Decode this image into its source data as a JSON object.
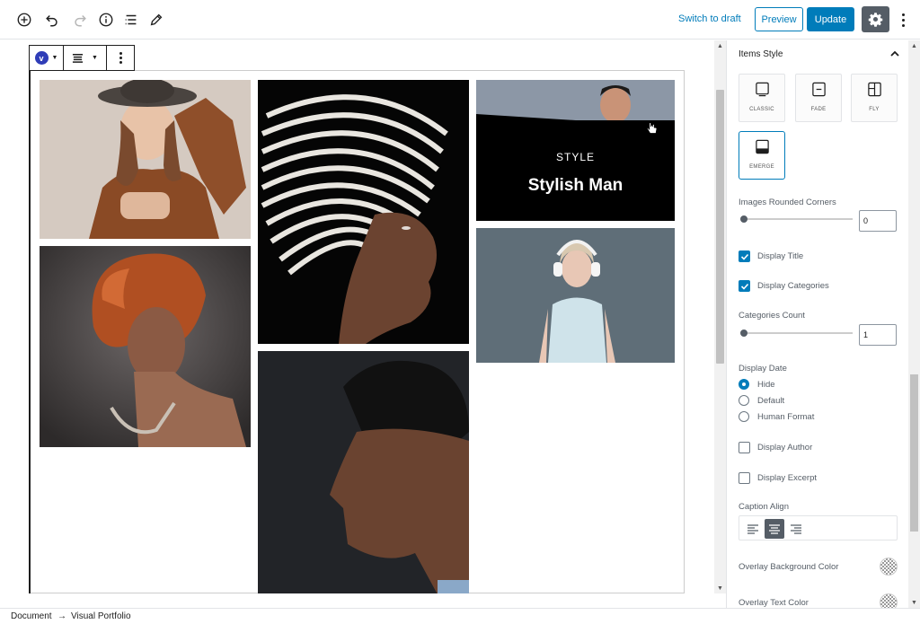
{
  "toolbar": {
    "icons": [
      "add-block-icon",
      "undo-icon",
      "redo-icon",
      "info-icon",
      "list-view-icon",
      "edit-tools-icon"
    ],
    "switch_draft": "Switch to draft",
    "preview": "Preview",
    "update": "Update",
    "settings_icon": "gear-icon",
    "more_icon": "more-vertical-icon",
    "accent_color": "#007cba"
  },
  "block_toolbar": {
    "block_icon_letter": "v",
    "block_icon": "visual-portfolio-icon",
    "align_icon": "align-justify-icon",
    "more_icon": "more-vertical-icon"
  },
  "gallery": {
    "items": [
      {
        "name": "woman-with-hat",
        "description": "woman in hat"
      },
      {
        "name": "woman-red-hair",
        "description": "woman red hair"
      },
      {
        "name": "woman-striped-headwrap",
        "description": "woman striped headwrap"
      },
      {
        "name": "man-profile",
        "description": "man profile"
      },
      {
        "name": "stylish-man",
        "description": "man"
      },
      {
        "name": "woman-headphones",
        "description": "woman headphones"
      }
    ],
    "hover_caption": {
      "category": "STYLE",
      "title": "Stylish Man"
    }
  },
  "sidebar": {
    "panel_title": "Items Style",
    "styles": [
      {
        "label": "CLASSIC",
        "icon": "classic-style-icon",
        "active": false
      },
      {
        "label": "FADE",
        "icon": "fade-style-icon",
        "active": false
      },
      {
        "label": "FLY",
        "icon": "fly-style-icon",
        "active": false
      },
      {
        "label": "EMERGE",
        "icon": "emerge-style-icon",
        "active": true
      }
    ],
    "rounded_corners": {
      "label": "Images Rounded Corners",
      "value": "0",
      "slider_fraction": 0
    },
    "display_title": {
      "label": "Display Title",
      "checked": true
    },
    "display_categories": {
      "label": "Display Categories",
      "checked": true
    },
    "categories_count": {
      "label": "Categories Count",
      "value": "1",
      "slider_fraction": 0
    },
    "display_date": {
      "label": "Display Date",
      "options": [
        {
          "label": "Hide",
          "selected": true
        },
        {
          "label": "Default",
          "selected": false
        },
        {
          "label": "Human Format",
          "selected": false
        }
      ]
    },
    "display_author": {
      "label": "Display Author",
      "checked": false
    },
    "display_excerpt": {
      "label": "Display Excerpt",
      "checked": false
    },
    "caption_align": {
      "label": "Caption Align",
      "options": [
        "align-left-icon",
        "align-center-icon",
        "align-right-icon"
      ],
      "selected": "align-center-icon"
    },
    "overlay_bg_color": {
      "label": "Overlay Background Color"
    },
    "overlay_text_color": {
      "label": "Overlay Text Color"
    }
  },
  "footer": {
    "crumb_1": "Document",
    "separator": "→",
    "crumb_2": "Visual Portfolio"
  }
}
